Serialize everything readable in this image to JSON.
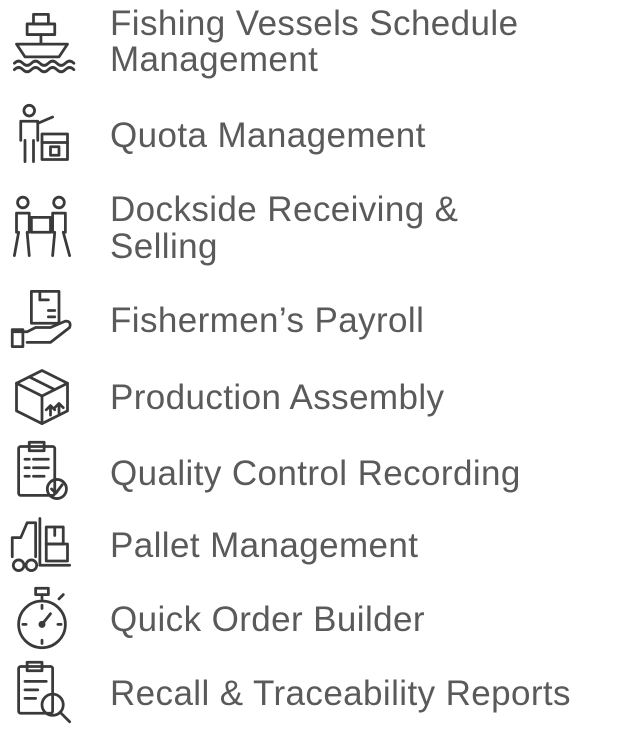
{
  "features": [
    {
      "label": "Fishing Vessels Schedule",
      "label_line2": "Management",
      "icon": "fishing-vessel-icon"
    },
    {
      "label": "Quota Management",
      "icon": "quota-person-icon"
    },
    {
      "label": "Dockside Receiving &",
      "label_line2": "Selling",
      "icon": "dockside-exchange-icon"
    },
    {
      "label": "Fishermen’s Payroll",
      "icon": "payroll-hand-icon"
    },
    {
      "label": "Production Assembly",
      "icon": "production-box-icon"
    },
    {
      "label": "Quality Control Recording",
      "icon": "quality-clipboard-icon"
    },
    {
      "label": "Pallet Management",
      "icon": "forklift-icon"
    },
    {
      "label": "Quick Order Builder",
      "icon": "stopwatch-icon"
    },
    {
      "label": "Recall & Traceability Reports",
      "icon": "report-search-icon"
    }
  ],
  "colors": {
    "text": "#5a5a5a",
    "icon_stroke": "#3a3a3a"
  }
}
